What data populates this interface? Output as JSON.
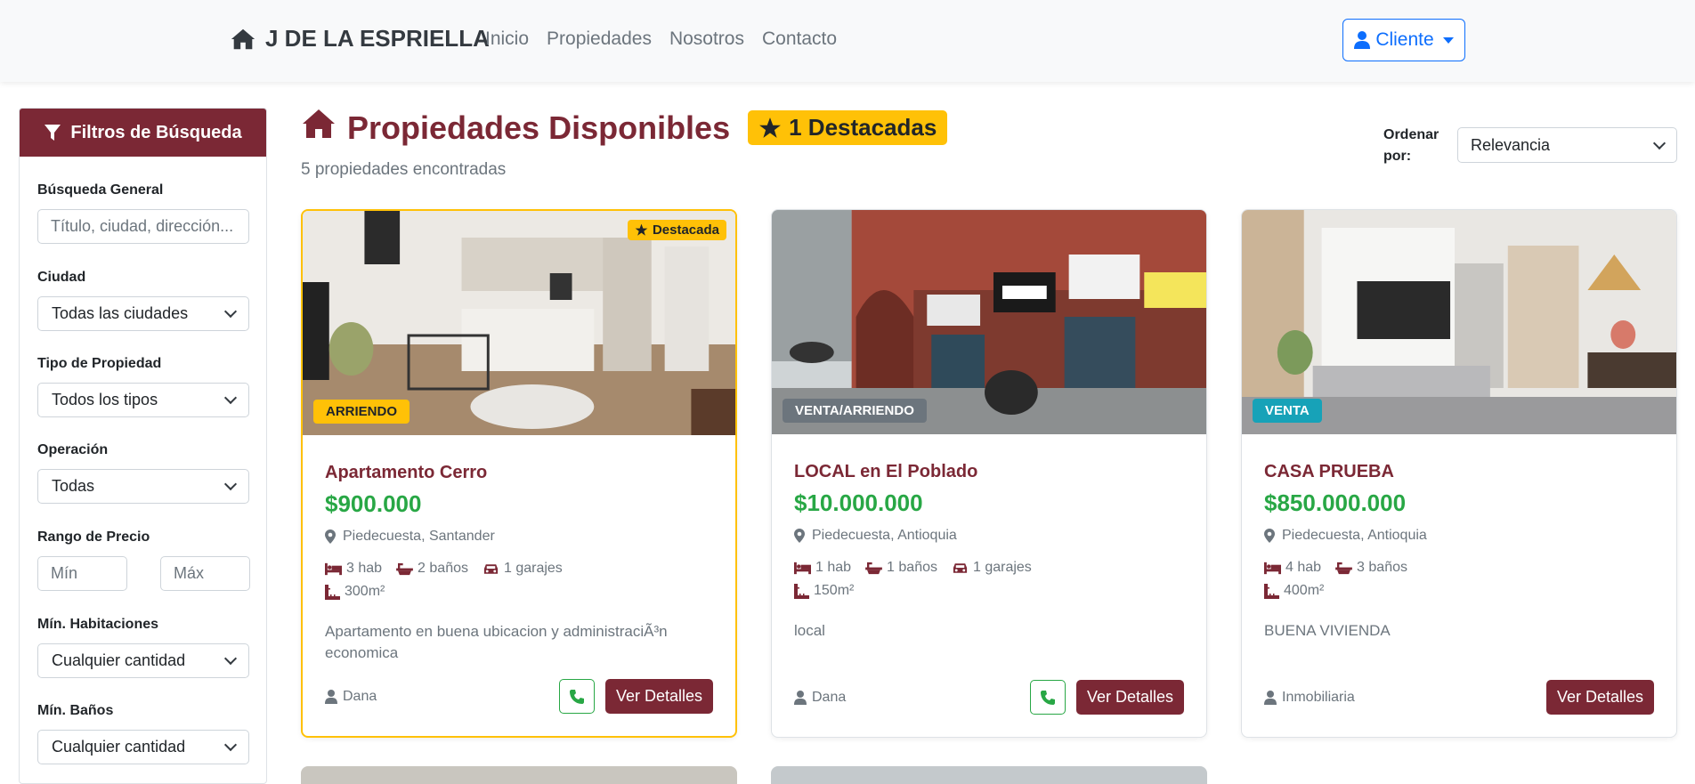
{
  "navbar": {
    "brand": "J DE LA ESPRIELLA",
    "links": [
      "Inicio",
      "Propiedades",
      "Nosotros",
      "Contacto"
    ],
    "cliente_label": "Cliente"
  },
  "sidebar": {
    "header": "Filtros de Búsqueda",
    "busqueda_label": "Búsqueda General",
    "busqueda_placeholder": "Título, ciudad, dirección...",
    "ciudad_label": "Ciudad",
    "ciudad_value": "Todas las ciudades",
    "tipo_label": "Tipo de Propiedad",
    "tipo_value": "Todos los tipos",
    "operacion_label": "Operación",
    "operacion_value": "Todas",
    "precio_label": "Rango de Precio",
    "precio_min": "Mín",
    "precio_max": "Máx",
    "hab_label": "Mín. Habitaciones",
    "hab_value": "Cualquier cantidad",
    "banos_label": "Mín. Baños",
    "banos_value": "Cualquier cantidad"
  },
  "main": {
    "title": "Propiedades Disponibles",
    "destacadas_badge": "1 Destacadas",
    "count_text": "5 propiedades encontradas",
    "order_label_1": "Ordenar",
    "order_label_2": "por:",
    "order_value": "Relevancia"
  },
  "cards": [
    {
      "featured_label": "Destacada",
      "operation": "ARRIENDO",
      "title": "Apartamento Cerro",
      "price": "$900.000",
      "location": "Piedecuesta, Santander",
      "hab": "3 hab",
      "banos": "2 baños",
      "garajes": "1 garajes",
      "area": "300m²",
      "description": "Apartamento en buena ubicacion y administraciÃ³n economica",
      "agent": "Dana",
      "details_label": "Ver Detalles"
    },
    {
      "operation": "VENTA/ARRIENDO",
      "title": "LOCAL en El Poblado",
      "price": "$10.000.000",
      "location": "Piedecuesta, Antioquia",
      "hab": "1 hab",
      "banos": "1 baños",
      "garajes": "1 garajes",
      "area": "150m²",
      "description": "local",
      "agent": "Dana",
      "details_label": "Ver Detalles"
    },
    {
      "operation": "VENTA",
      "title": "CASA PRUEBA",
      "price": "$850.000.000",
      "location": "Piedecuesta, Antioquia",
      "hab": "4 hab",
      "banos": "3 baños",
      "area": "400m²",
      "description": "BUENA VIVIENDA",
      "agent": "Inmobiliaria",
      "details_label": "Ver Detalles"
    }
  ],
  "colors": {
    "brand": "#7b2835",
    "price": "#28a745",
    "featured": "#ffc107",
    "primary": "#0d6efd",
    "badge_venta": "#17a2b8",
    "badge_mixed": "#6c757d"
  }
}
